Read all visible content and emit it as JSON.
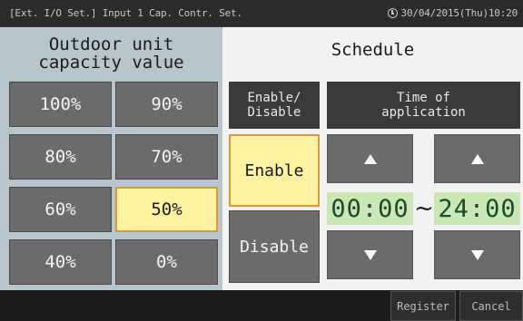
{
  "titlebar": {
    "title": "[Ext. I/O Set.] Input 1 Cap. Contr. Set.",
    "datetime": "30/04/2015(Thu)10:20",
    "clock_icon": "clock-icon"
  },
  "capacity": {
    "header_line1": "Outdoor unit",
    "header_line2": "capacity value",
    "options": [
      "100%",
      "90%",
      "80%",
      "70%",
      "60%",
      "50%",
      "40%",
      "0%"
    ],
    "selected": "50%"
  },
  "schedule": {
    "title": "Schedule",
    "enable_header_line1": "Enable/",
    "enable_header_line2": "Disable",
    "time_header_line1": "Time of",
    "time_header_line2": "application",
    "enable_label": "Enable",
    "disable_label": "Disable",
    "enable_state": "Enable",
    "start_time": "00:00",
    "separator": "~",
    "end_time": "24:00",
    "up_icon": "triangle-up-icon",
    "down_icon": "triangle-down-icon"
  },
  "footer": {
    "register_label": "Register",
    "cancel_label": "Cancel"
  },
  "colors": {
    "selected_bg": "#fff2a0",
    "selected_border": "#d89a3a",
    "time_bg": "#c9e8b6",
    "button_gray": "#6b6b6b",
    "left_panel_bg": "#b8c6cc"
  }
}
